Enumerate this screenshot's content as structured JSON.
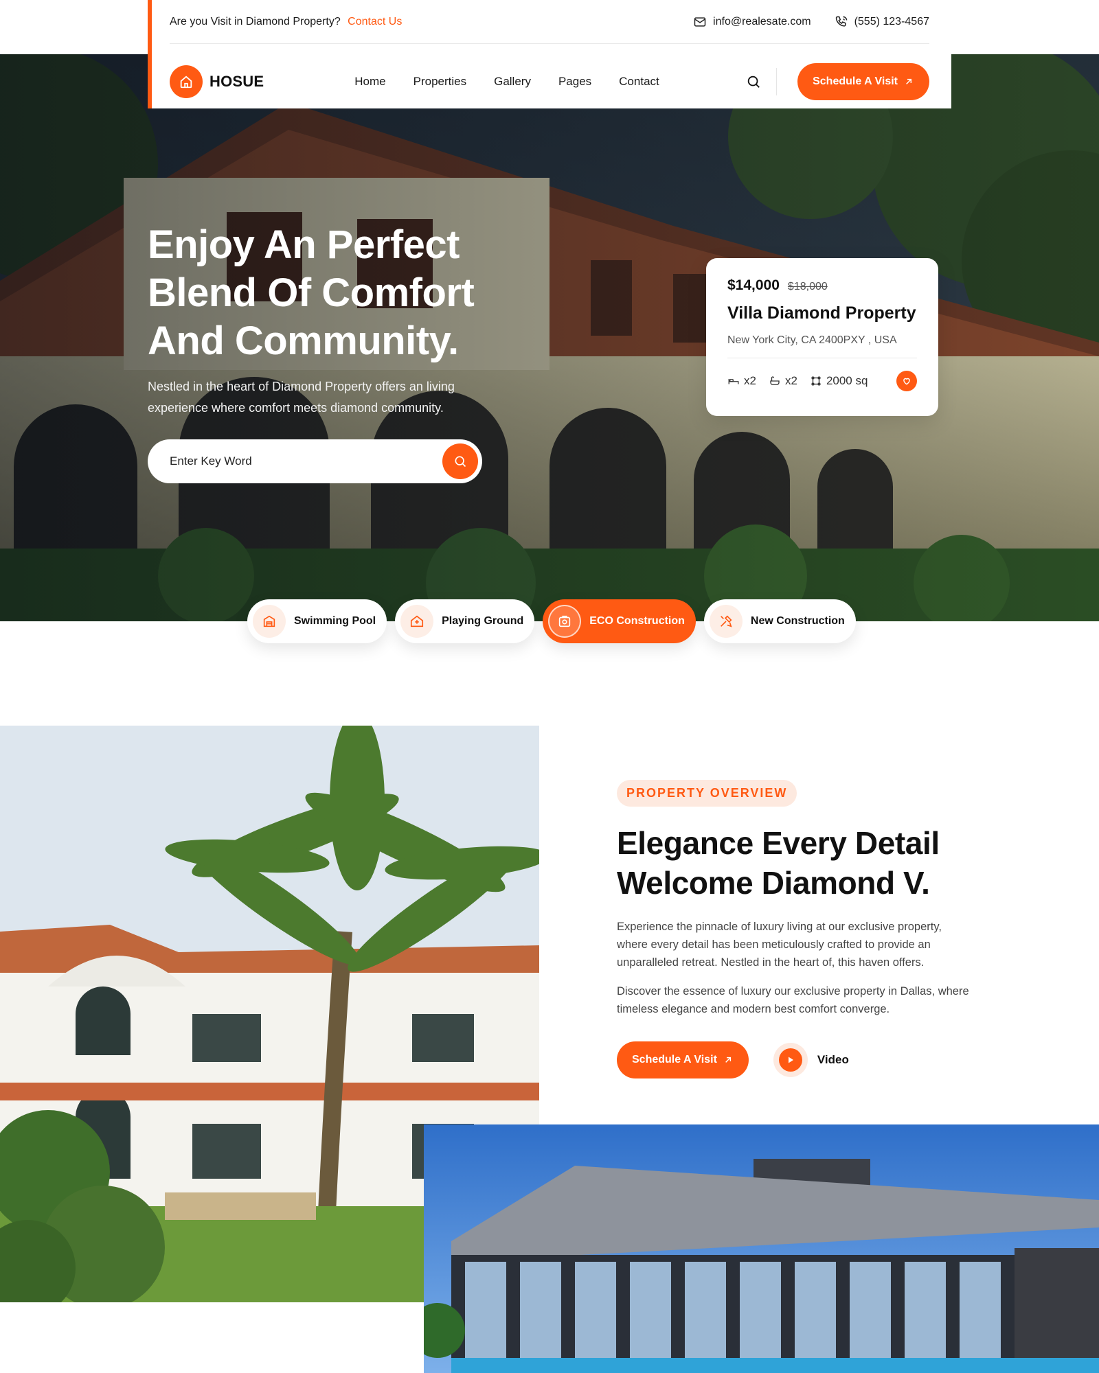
{
  "topbar": {
    "question": "Are you Visit in Diamond Property?",
    "contact_link": "Contact Us",
    "email": "info@realesate.com",
    "phone": "(555) 123-4567"
  },
  "nav": {
    "brand": "HOSUE",
    "menu": [
      "Home",
      "Properties",
      "Gallery",
      "Pages",
      "Contact"
    ],
    "cta": "Schedule A Visit"
  },
  "hero": {
    "title": "Enjoy An Perfect Blend Of Comfort And Community.",
    "subtitle": "Nestled in the heart of Diamond Property offers an  living experience where comfort meets diamond community.",
    "search_placeholder": "Enter Key Word"
  },
  "property_card": {
    "price": "$14,000",
    "old_price": "$18,000",
    "name": "Villa  Diamond Property",
    "location": "New York City, CA 2400PXY , USA",
    "beds": "x2",
    "baths": "x2",
    "area": "2000 sq"
  },
  "features": [
    {
      "label": "Swimming Pool",
      "icon": "pool-icon"
    },
    {
      "label": "Playing Ground",
      "icon": "ground-icon"
    },
    {
      "label": "ECO Construction",
      "icon": "eco-icon",
      "active": true
    },
    {
      "label": "New Construction",
      "icon": "tools-icon"
    }
  ],
  "overview": {
    "tag": "PROPERTY OVERVIEW",
    "title": "Elegance Every Detail Welcome Diamond V.",
    "para1": "Experience the pinnacle of luxury living at our exclusive property, where every detail has been meticulously crafted to provide an unparalleled retreat. Nestled in the heart of, this haven offers.",
    "para2": "Discover the essence of luxury  our exclusive property in Dallas, where timeless elegance and modern best comfort converge.",
    "cta": "Schedule A Visit",
    "video_label": "Video"
  },
  "colors": {
    "accent": "#ff5a13",
    "accent_soft": "#fde9df",
    "text_dark": "#111111"
  }
}
